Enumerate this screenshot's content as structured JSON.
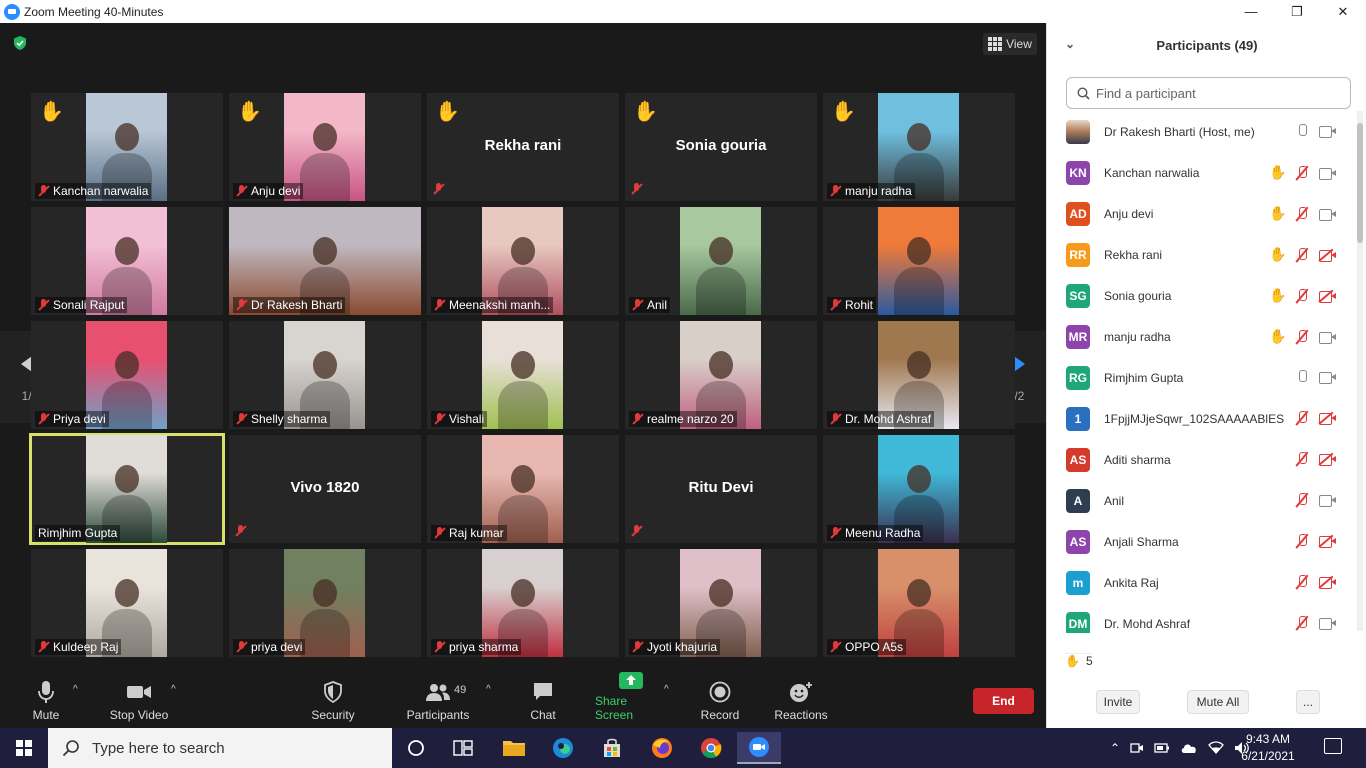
{
  "window": {
    "title": "Zoom Meeting 40-Minutes",
    "minimize": "—",
    "maximize": "❐",
    "close": "✕"
  },
  "meeting": {
    "view_label": "View",
    "page_indicator_left": "1/2",
    "page_indicator_right": "1/2",
    "tiles": [
      {
        "name": "Kanchan narwalia",
        "hand": true,
        "video": true,
        "c1": "#b9c7d6",
        "c2": "#5a6f85"
      },
      {
        "name": "Anju devi",
        "hand": true,
        "video": true,
        "c1": "#f3b7c8",
        "c2": "#c85585"
      },
      {
        "name": "Rekha rani",
        "hand": true,
        "video": false
      },
      {
        "name": "Sonia gouria",
        "hand": true,
        "video": false
      },
      {
        "name": "manju radha",
        "hand": true,
        "video": true,
        "c1": "#6fc0e0",
        "c2": "#3a3a3a"
      },
      {
        "name": "Sonali Rajput",
        "hand": false,
        "video": true,
        "c1": "#f2c0d4",
        "c2": "#d07aa0"
      },
      {
        "name": "Dr Rakesh Bharti",
        "hand": false,
        "video": true,
        "wide": true,
        "c1": "#c0b8c0",
        "c2": "#8a4a30"
      },
      {
        "name": "Meenakshi manh...",
        "hand": false,
        "video": true,
        "c1": "#e8c8c0",
        "c2": "#b05060"
      },
      {
        "name": "Anil",
        "hand": false,
        "video": true,
        "c1": "#a8c8a0",
        "c2": "#4a6a4a"
      },
      {
        "name": "Rohit",
        "hand": false,
        "video": true,
        "c1": "#f07a3a",
        "c2": "#2a5aa0"
      },
      {
        "name": "Priya devi",
        "hand": false,
        "video": true,
        "c1": "#e85070",
        "c2": "#70a0c8"
      },
      {
        "name": "Shelly sharma",
        "hand": false,
        "video": true,
        "c1": "#d8d4d0",
        "c2": "#9a9490"
      },
      {
        "name": "Vishali",
        "hand": false,
        "video": true,
        "c1": "#e8e0d8",
        "c2": "#a0c050"
      },
      {
        "name": "realme narzo 20",
        "hand": false,
        "video": true,
        "c1": "#d8d0c8",
        "c2": "#c06080"
      },
      {
        "name": "Dr. Mohd Ashraf",
        "hand": false,
        "video": true,
        "c1": "#a07850",
        "c2": "#e8e8f0"
      },
      {
        "name": "Rimjhim Gupta",
        "hand": false,
        "video": true,
        "active": true,
        "micOn": true,
        "c1": "#e0dcd8",
        "c2": "#2a4a3a"
      },
      {
        "name": "Vivo 1820",
        "hand": false,
        "video": false
      },
      {
        "name": "Raj kumar",
        "hand": false,
        "video": true,
        "c1": "#e8b8b0",
        "c2": "#a06050"
      },
      {
        "name": "Ritu Devi",
        "hand": false,
        "video": false
      },
      {
        "name": "Meenu Radha",
        "hand": false,
        "video": true,
        "c1": "#40b8d8",
        "c2": "#3a3050"
      },
      {
        "name": "Kuldeep Raj",
        "hand": false,
        "video": true,
        "c1": "#e8e4dc",
        "c2": "#b0a8a0"
      },
      {
        "name": "priya devi",
        "hand": false,
        "video": true,
        "c1": "#708060",
        "c2": "#a06050"
      },
      {
        "name": "priya sharma",
        "hand": false,
        "video": true,
        "c1": "#d8d0d0",
        "c2": "#c03040"
      },
      {
        "name": "Jyoti khajuria",
        "hand": false,
        "video": true,
        "c1": "#e0c0c8",
        "c2": "#806050"
      },
      {
        "name": "OPPO A5s",
        "hand": false,
        "video": true,
        "c1": "#d8906a",
        "c2": "#c04040"
      }
    ]
  },
  "toolbar": {
    "mute": "Mute",
    "stop_video": "Stop Video",
    "security": "Security",
    "participants": "Participants",
    "participants_count": "49",
    "chat": "Chat",
    "share_screen": "Share Screen",
    "record": "Record",
    "reactions": "Reactions",
    "end": "End"
  },
  "panel": {
    "title": "Participants (49)",
    "search_placeholder": "Find a participant",
    "participants": [
      {
        "name": "Dr Rakesh Bharti (Host, me)",
        "initials": "",
        "color": "#7a5a40",
        "hand": false,
        "mic": "on",
        "cam": "on",
        "photo": true
      },
      {
        "name": "Kanchan narwalia",
        "initials": "KN",
        "color": "#8e44ad",
        "hand": true,
        "mic": "off",
        "cam": "on"
      },
      {
        "name": "Anju devi",
        "initials": "AD",
        "color": "#e0501e",
        "hand": true,
        "mic": "off",
        "cam": "on"
      },
      {
        "name": "Rekha rani",
        "initials": "RR",
        "color": "#f59b1d",
        "hand": true,
        "mic": "off",
        "cam": "off"
      },
      {
        "name": "Sonia gouria",
        "initials": "SG",
        "color": "#1fa67a",
        "hand": true,
        "mic": "off",
        "cam": "off"
      },
      {
        "name": "manju radha",
        "initials": "MR",
        "color": "#8e44ad",
        "hand": true,
        "mic": "off",
        "cam": "on"
      },
      {
        "name": "Rimjhim Gupta",
        "initials": "RG",
        "color": "#1fa67a",
        "hand": false,
        "mic": "on",
        "cam": "on"
      },
      {
        "name": "1FpjjMJjeSqwr_102SAAAAABlES...",
        "initials": "1",
        "color": "#2a6fc0",
        "hand": false,
        "mic": "off",
        "cam": "off"
      },
      {
        "name": "Aditi sharma",
        "initials": "AS",
        "color": "#d63a2a",
        "hand": false,
        "mic": "off",
        "cam": "off"
      },
      {
        "name": "Anil",
        "initials": "A",
        "color": "#2c3e50",
        "hand": false,
        "mic": "off",
        "cam": "on"
      },
      {
        "name": "Anjali Sharma",
        "initials": "AS",
        "color": "#8e44ad",
        "hand": false,
        "mic": "off",
        "cam": "off"
      },
      {
        "name": "Ankita Raj",
        "initials": "m",
        "color": "#1a9fd0",
        "hand": false,
        "mic": "off",
        "cam": "off"
      },
      {
        "name": "Dr. Mohd Ashraf",
        "initials": "DM",
        "color": "#1fa67a",
        "hand": false,
        "mic": "off",
        "cam": "on"
      }
    ],
    "hands_count": "5",
    "invite": "Invite",
    "mute_all": "Mute All",
    "more": "..."
  },
  "taskbar": {
    "search_placeholder": "Type here to search",
    "time": "9:43 AM",
    "date": "6/21/2021"
  }
}
